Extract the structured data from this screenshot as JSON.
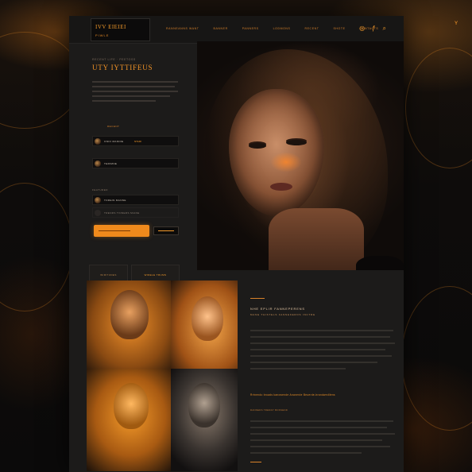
{
  "brand": {
    "title": "IVV EIEIEI",
    "subtitle": "PIWLE"
  },
  "nav": {
    "items": [
      "RANNEANNS WANT",
      "BANNER",
      "PANNERS",
      "LODMONS",
      "RECENT",
      "SHOTE",
      "CONTACTS"
    ],
    "icons": [
      "instagram-icon",
      "facebook-icon",
      "search-icon"
    ]
  },
  "hero": {
    "eyebrow": "RECENT LIFE · PEETOSS",
    "title": "UTY IYTTIFEUS"
  },
  "list": {
    "section_label_1": "RECENT",
    "section_label_2": "FEATURED",
    "items": [
      {
        "label": "ONIO MANNIE",
        "tag": "NTAIR"
      },
      {
        "label": "TERIMNE",
        "tag": ""
      },
      {
        "label": "TOREIN MANNE",
        "tag": ""
      },
      {
        "label": "TRENDS TINNERS MIANE",
        "tag": ""
      }
    ]
  },
  "stats": {
    "left": "WIRITUDES",
    "right": "WIDELE TRUMS"
  },
  "article": {
    "heading": "NHE EPLIR FANNEPERENS",
    "sub": "MANE  THISTELS  FANNEKEROS  INCTRE",
    "link": "Rrtnendo broads kanowende Ananerde Beuerde-brandwedilens",
    "meta": "RANNEDS TRENDY BONSEND"
  },
  "gallery": {
    "controls": [
      "chevron-left-icon",
      "image-icon",
      "play-icon",
      "chevron-right-icon"
    ]
  },
  "colors": {
    "accent": "#f08a1c",
    "background": "#1c1b1a",
    "page_background": "#0d0c0b"
  }
}
